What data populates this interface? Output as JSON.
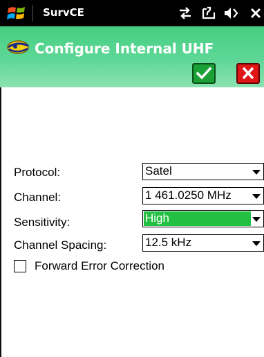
{
  "taskbar": {
    "app_name": "SurvCE",
    "icons": [
      "windows-start-icon",
      "connectivity-icon",
      "sync-icon",
      "speaker-icon",
      "close-icon"
    ]
  },
  "header": {
    "title": "Configure Internal UHF",
    "app_icon": "survce-logo-icon",
    "accent_color": "#5ed796"
  },
  "buttons": {
    "ok_icon": "checkmark-icon",
    "ok_color": "#1ba035",
    "cancel_icon": "x-icon",
    "cancel_color": "#e01616"
  },
  "form": {
    "protocol": {
      "label": "Protocol:",
      "value": "Satel"
    },
    "channel": {
      "label": "Channel:",
      "value": "1 461.0250 MHz"
    },
    "sensitivity": {
      "label": "Sensitivity:",
      "value": "High",
      "highlight_color": "#22c042"
    },
    "channel_spacing": {
      "label": "Channel Spacing:",
      "value": "12.5 kHz"
    },
    "fec": {
      "label": "Forward Error Correction",
      "checked": false
    }
  }
}
